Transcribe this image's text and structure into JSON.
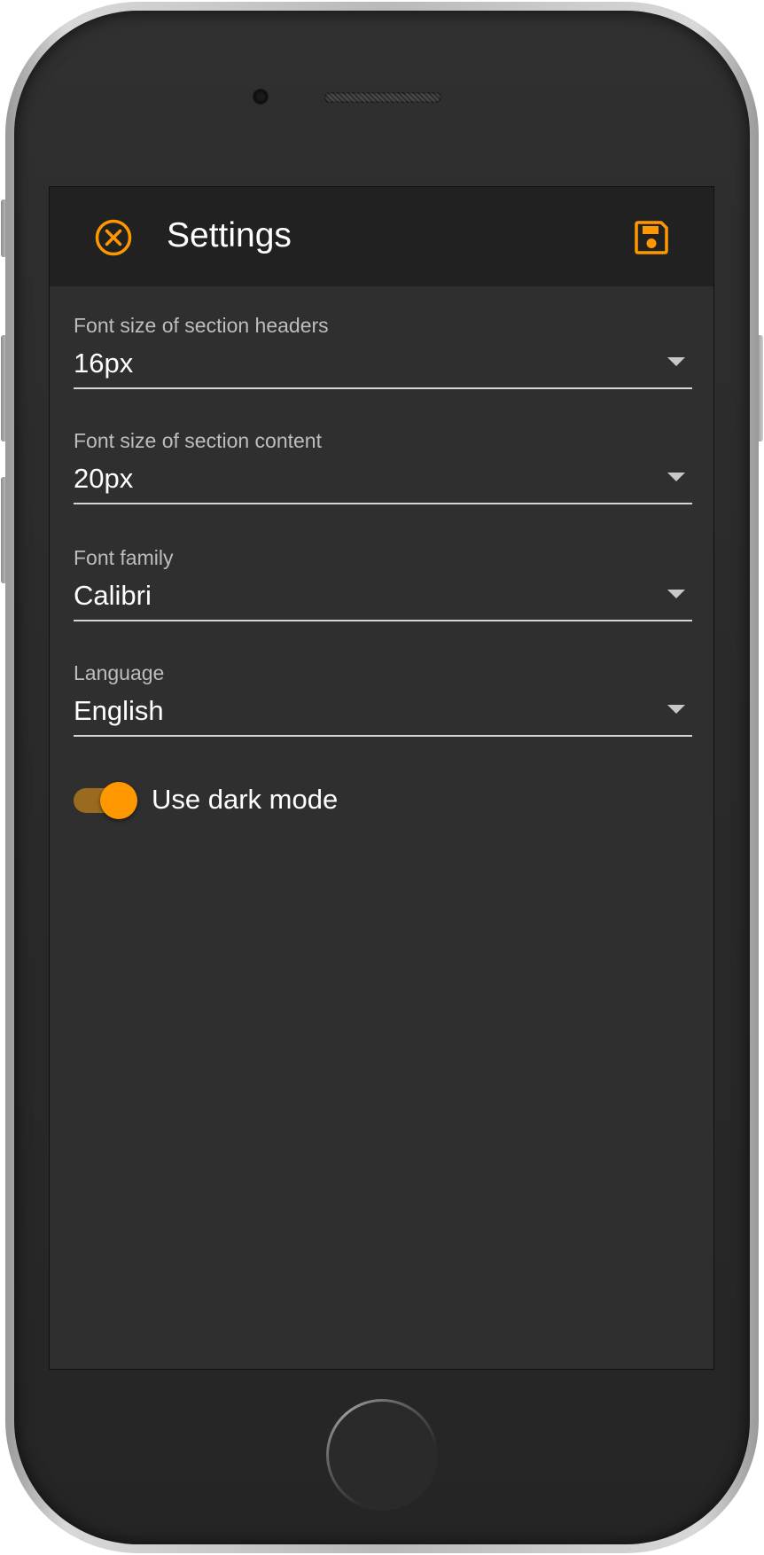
{
  "app_bar": {
    "title": "Settings",
    "close_icon": "close-circle-icon",
    "save_icon": "floppy-disk-icon",
    "accent_color": "#ff9800"
  },
  "fields": [
    {
      "label": "Font size of section headers",
      "value": "16px"
    },
    {
      "label": "Font size of section content",
      "value": "20px"
    },
    {
      "label": "Font family",
      "value": "Calibri"
    },
    {
      "label": "Language",
      "value": "English"
    }
  ],
  "dark_mode": {
    "label": "Use dark mode",
    "enabled": true
  },
  "colors": {
    "screen_background": "#2f2f2f",
    "app_bar_background": "#212121",
    "accent": "#ff9800"
  }
}
